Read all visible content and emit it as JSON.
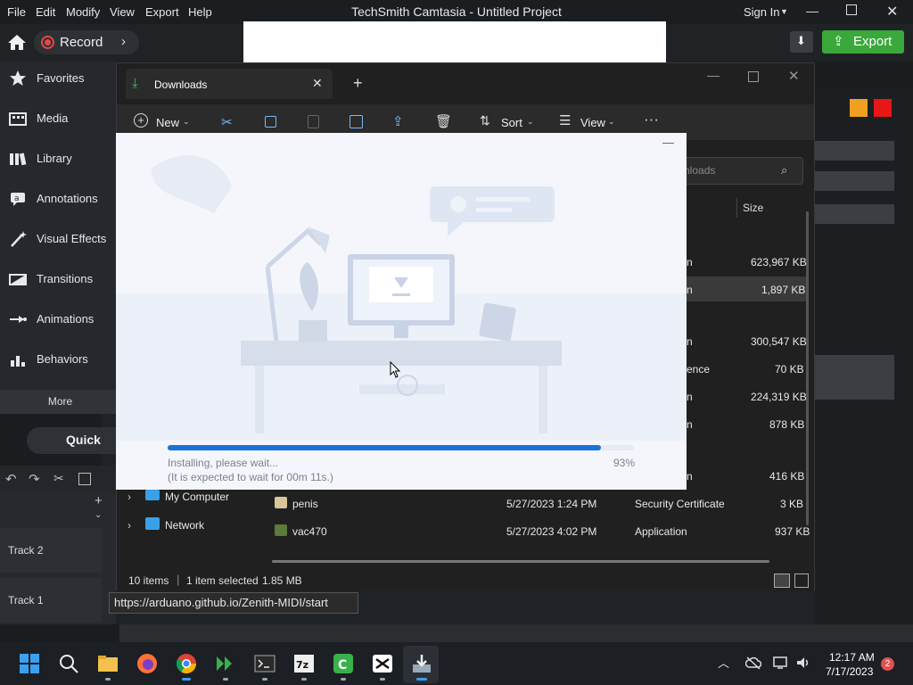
{
  "camtasia": {
    "menu": [
      "File",
      "Edit",
      "Modify",
      "View",
      "Export",
      "Help"
    ],
    "title": "TechSmith Camtasia - Untitled Project",
    "sign_in": "Sign In",
    "record_label": "Record",
    "export_label": "Export",
    "sidebar": [
      {
        "label": "Favorites",
        "icon": "star-icon"
      },
      {
        "label": "Media",
        "icon": "film-icon"
      },
      {
        "label": "Library",
        "icon": "library-icon"
      },
      {
        "label": "Annotations",
        "icon": "annotation-icon"
      },
      {
        "label": "Visual Effects",
        "icon": "wand-icon"
      },
      {
        "label": "Transitions",
        "icon": "transition-icon"
      },
      {
        "label": "Animations",
        "icon": "animation-icon"
      },
      {
        "label": "Behaviors",
        "icon": "behavior-icon"
      }
    ],
    "more_label": "More",
    "quick_label": "Quick",
    "tracks": [
      "Track 2",
      "Track 1"
    ],
    "accent": "#3aa83a"
  },
  "explorer": {
    "tab_label": "Downloads",
    "ribbon": {
      "new": "New",
      "sort": "Sort",
      "view": "View"
    },
    "search_placeholder": "nloads",
    "size_header": "Size",
    "size_column": [
      {
        "type": "n",
        "size": "623,967 KB"
      },
      {
        "type": "n",
        "size": "1,897 KB"
      },
      {
        "type": "n",
        "size": "300,547 KB"
      },
      {
        "type": "ence",
        "size": "70 KB"
      },
      {
        "type": "n",
        "size": "224,319 KB"
      },
      {
        "type": "n",
        "size": "878 KB"
      },
      {
        "type": "n",
        "size": "416 KB"
      }
    ],
    "nav": [
      "My Computer",
      "Network"
    ],
    "files": [
      {
        "name": "penis",
        "date": "5/27/2023 1:24 PM",
        "type": "Security Certificate",
        "size": "3 KB"
      },
      {
        "name": "vac470",
        "date": "5/27/2023 4:02 PM",
        "type": "Application",
        "size": "937 KB"
      }
    ],
    "status": {
      "items": "10 items",
      "selected": "1 item selected",
      "size": "1.85 MB"
    }
  },
  "installer": {
    "status": "Installing, please wait...",
    "eta": "(It is expected to wait for 00m 11s.)",
    "percent_label": "93%",
    "progress": 0.93,
    "minimize": "—"
  },
  "tooltip_url": "https://arduano.github.io/Zenith-MIDI/start",
  "taskbar": {
    "time": "12:17 AM",
    "date": "7/17/2023",
    "notifications": "2"
  }
}
